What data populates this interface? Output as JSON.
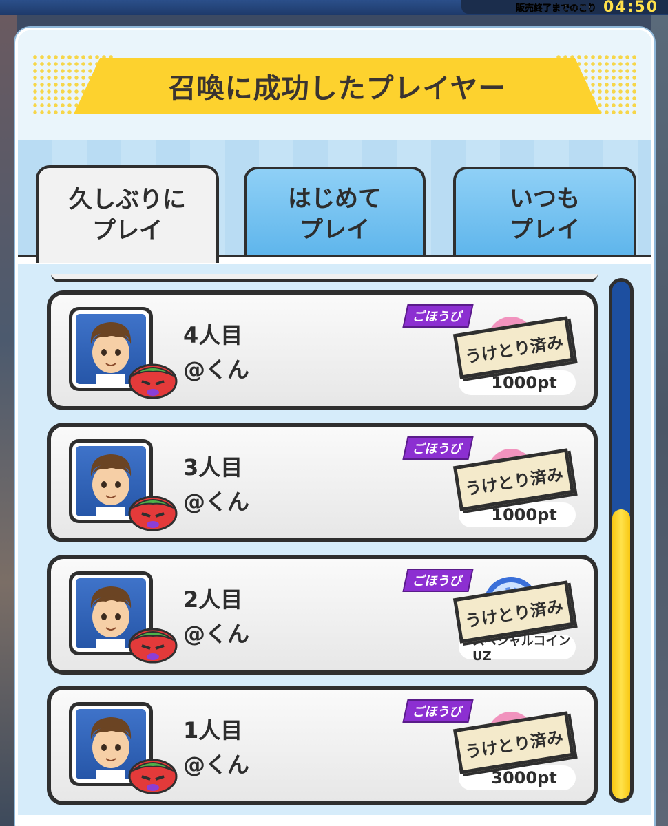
{
  "timer": {
    "label": "販売終了までのこり",
    "value": "04:50"
  },
  "dialog": {
    "title": "召喚に成功したプレイヤー"
  },
  "tabs": [
    {
      "label": "久しぶりに\nプレイ",
      "active": true
    },
    {
      "label": "はじめて\nプレイ",
      "active": false
    },
    {
      "label": "いつも\nプレイ",
      "active": false
    }
  ],
  "rows": [
    {
      "order": "4人目",
      "user": "@くん",
      "reward_tag": "ごほうび",
      "status": "うけとり済み",
      "reward": "1000pt"
    },
    {
      "order": "3人目",
      "user": "@くん",
      "reward_tag": "ごほうび",
      "status": "うけとり済み",
      "reward": "1000pt"
    },
    {
      "order": "2人目",
      "user": "@くん",
      "reward_tag": "ごほうび",
      "status": "うけとり済み",
      "reward": "スペシャルコインUZ"
    },
    {
      "order": "1人目",
      "user": "@くん",
      "reward_tag": "ごほうび",
      "status": "うけとり済み",
      "reward": "3000pt"
    }
  ],
  "scroll": {
    "position_fraction": 0.44
  },
  "colors": {
    "title_band": "#fdd22e",
    "tab_inactive": "#5cb4eb",
    "reward_tag": "#8c2fd1",
    "scroll_thumb": "#f8c814"
  }
}
